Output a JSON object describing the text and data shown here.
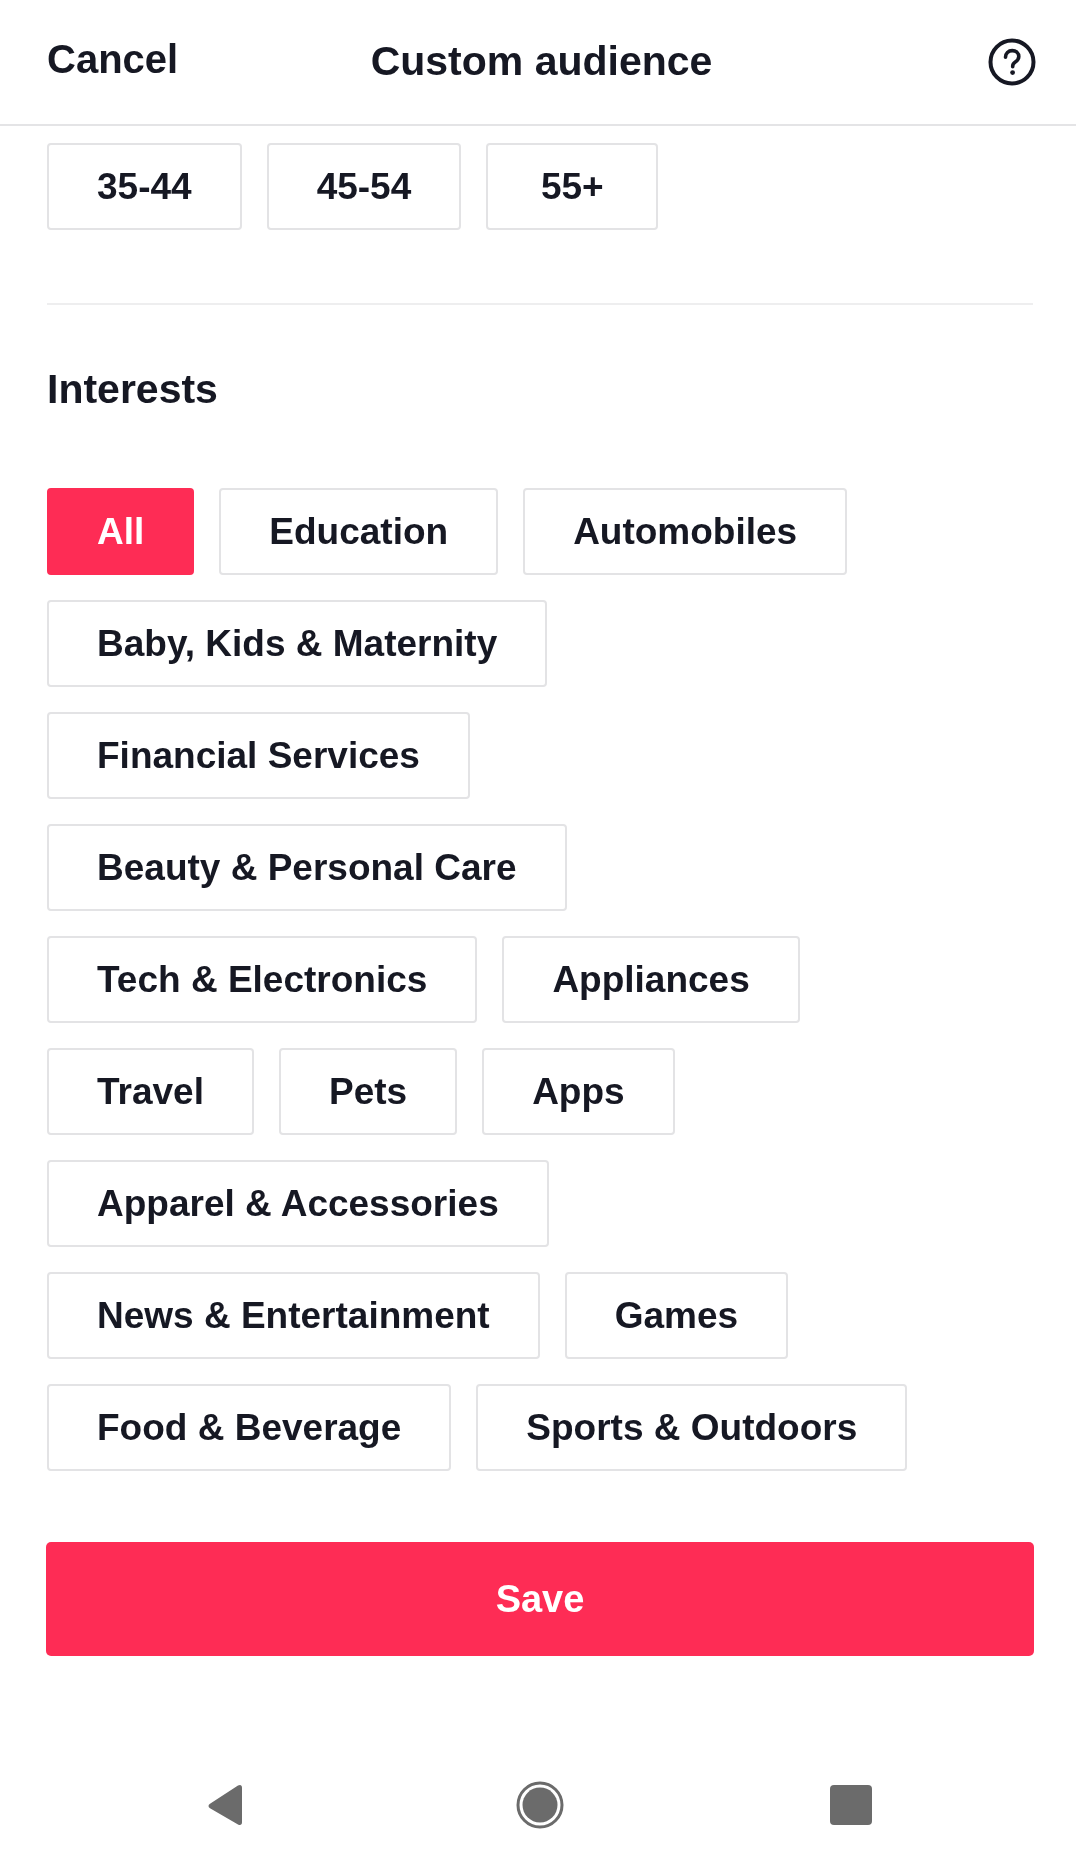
{
  "header": {
    "cancel": "Cancel",
    "title": "Custom audience"
  },
  "age_ranges": [
    {
      "label": "35-44",
      "selected": false
    },
    {
      "label": "45-54",
      "selected": false
    },
    {
      "label": "55+",
      "selected": false
    }
  ],
  "interests": {
    "title": "Interests",
    "options": [
      {
        "label": "All",
        "selected": true
      },
      {
        "label": "Education",
        "selected": false
      },
      {
        "label": "Automobiles",
        "selected": false
      },
      {
        "label": "Baby, Kids & Maternity",
        "selected": false
      },
      {
        "label": "Financial Services",
        "selected": false
      },
      {
        "label": "Beauty & Personal Care",
        "selected": false
      },
      {
        "label": "Tech & Electronics",
        "selected": false
      },
      {
        "label": "Appliances",
        "selected": false
      },
      {
        "label": "Travel",
        "selected": false
      },
      {
        "label": "Pets",
        "selected": false
      },
      {
        "label": "Apps",
        "selected": false
      },
      {
        "label": "Apparel & Accessories",
        "selected": false
      },
      {
        "label": "News & Entertainment",
        "selected": false
      },
      {
        "label": "Games",
        "selected": false
      },
      {
        "label": "Food & Beverage",
        "selected": false
      },
      {
        "label": "Sports & Outdoors",
        "selected": false
      }
    ]
  },
  "save_button": "Save"
}
